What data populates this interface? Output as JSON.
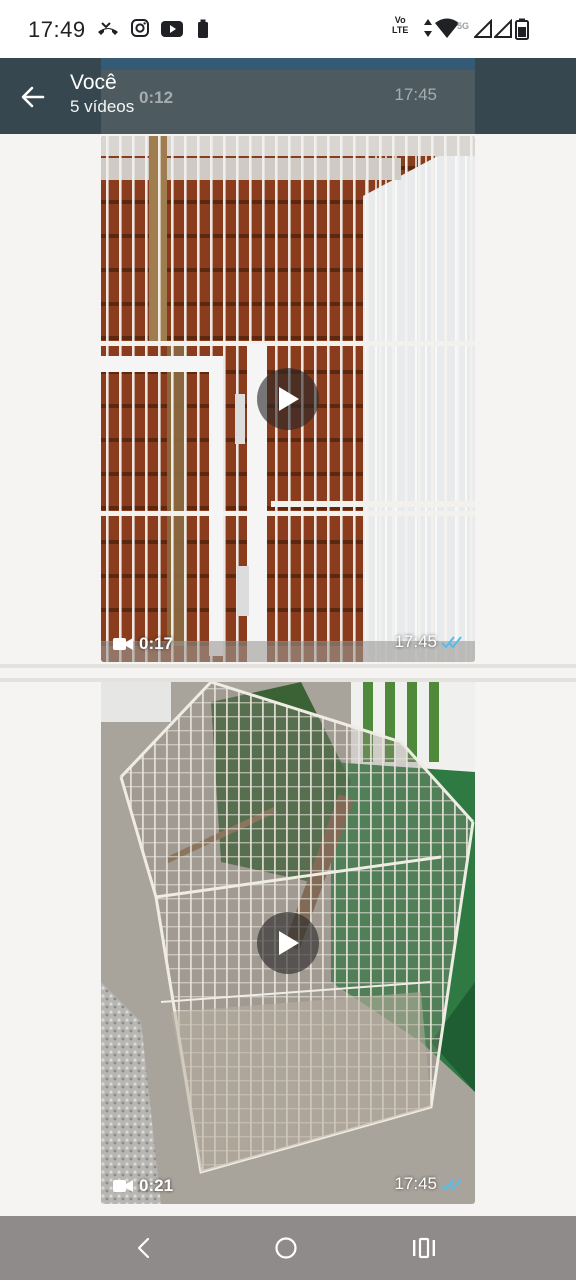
{
  "status_bar": {
    "time": "17:49",
    "volte_line1": "Vo",
    "volte_line2": "LTE",
    "network_5g": "5G",
    "icons": [
      "missed-call-icon",
      "instagram-icon",
      "youtube-icon",
      "battery-saver-icon",
      "data-arrows-icon",
      "wifi-icon",
      "signal-icon",
      "signal-icon",
      "battery-icon"
    ]
  },
  "header": {
    "title": "Você",
    "subtitle": "5 vídeos",
    "partial_card": {
      "duration": "0:12",
      "time": "17:45"
    }
  },
  "videos": [
    {
      "duration": "0:17",
      "time": "17:45",
      "status": "read",
      "description_icon": "cage-photo"
    },
    {
      "duration": "0:21",
      "time": "17:45",
      "status": "read",
      "description_icon": "cage-photo"
    }
  ],
  "colors": {
    "app_bar": "#37474f",
    "read_ticks": "#53bdeb",
    "content_bg": "#f5f4f2",
    "nav_bar": "#8e8b8a"
  }
}
